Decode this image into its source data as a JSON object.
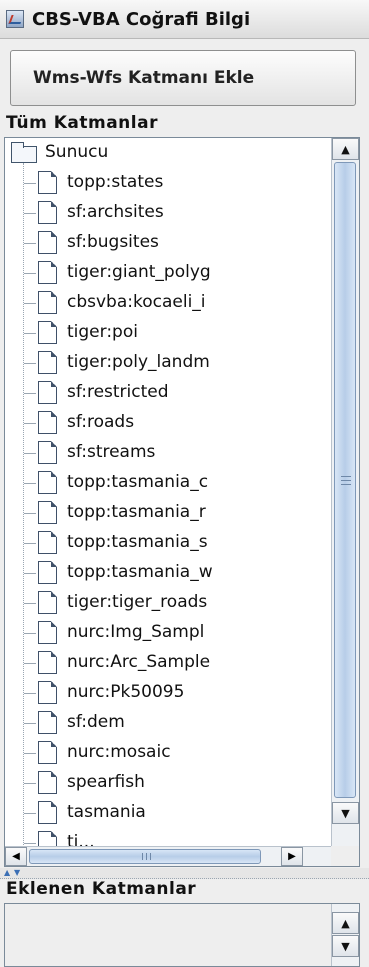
{
  "window": {
    "title": "CBS-VBA Coğrafi Bilgi"
  },
  "toolbar": {
    "add_layer_button": "Wms-Wfs Katmanı Ekle"
  },
  "all_layers": {
    "label": "Tüm Katmanlar",
    "root": "Sunucu",
    "items": [
      "topp:states",
      "sf:archsites",
      "sf:bugsites",
      "tiger:giant_polyg",
      "cbsvba:kocaeli_i",
      "tiger:poi",
      "tiger:poly_landm",
      "sf:restricted",
      "sf:roads",
      "sf:streams",
      "topp:tasmania_c",
      "topp:tasmania_r",
      "topp:tasmania_s",
      "topp:tasmania_w",
      "tiger:tiger_roads",
      "nurc:Img_Sampl",
      "nurc:Arc_Sample",
      "nurc:Pk50095",
      "sf:dem",
      "nurc:mosaic",
      "spearfish",
      "tasmania",
      "ti..."
    ]
  },
  "added_layers": {
    "label": "Eklenen Katmanlar",
    "items": []
  }
}
